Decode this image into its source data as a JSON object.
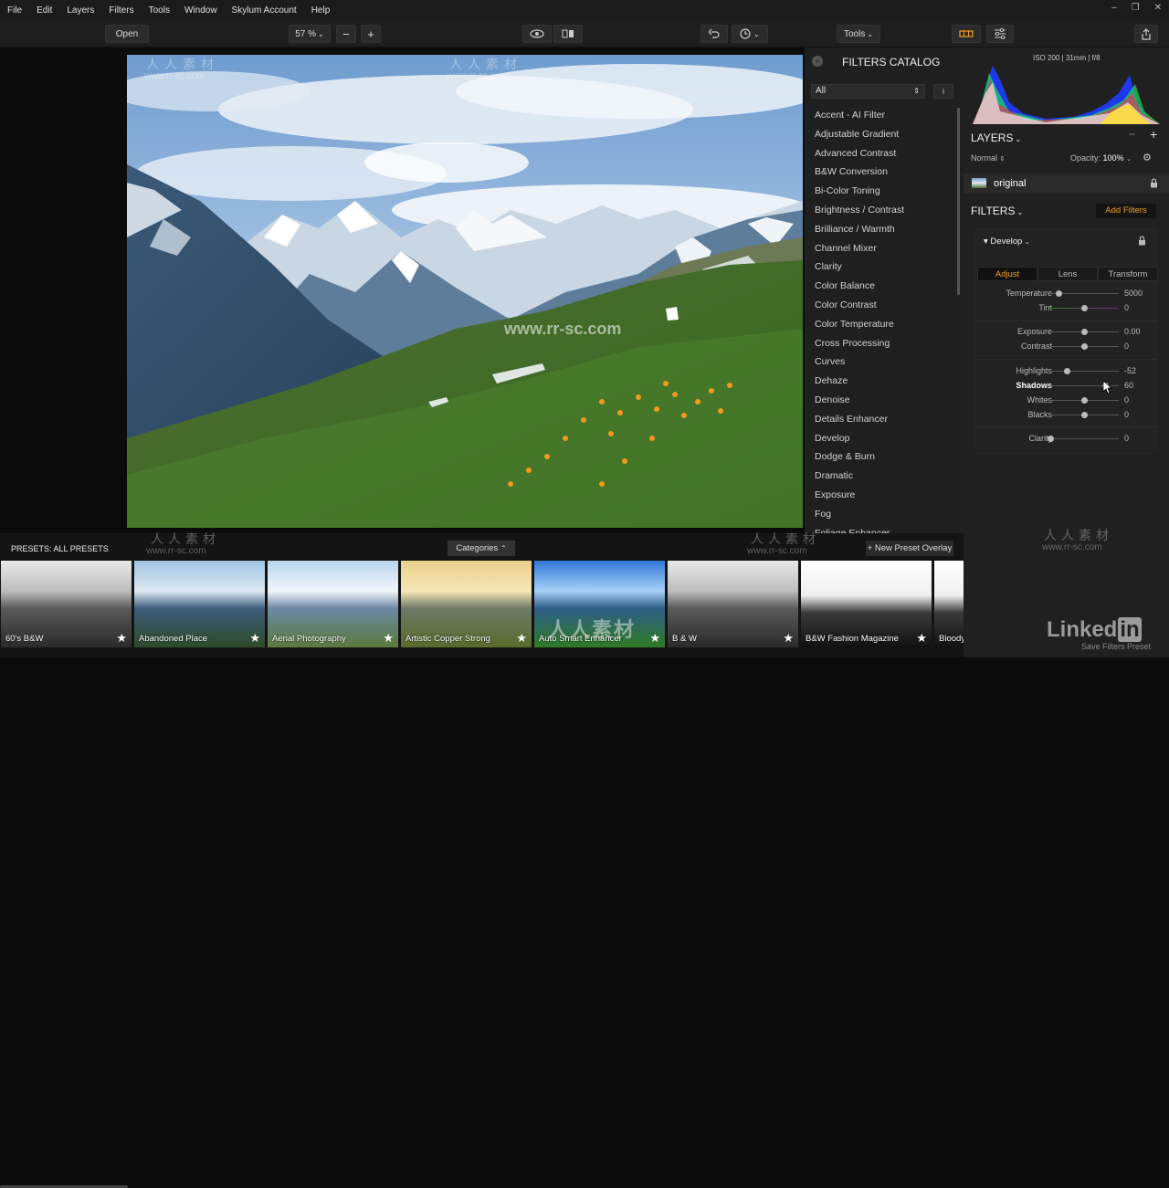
{
  "menu": [
    "File",
    "Edit",
    "Layers",
    "Filters",
    "Tools",
    "Window",
    "Skylum Account",
    "Help"
  ],
  "window_controls": {
    "minimize": "–",
    "maximize": "❐",
    "close": "✕"
  },
  "toolbar": {
    "open_label": "Open",
    "zoom_value": "57 %",
    "zoom_out": "−",
    "zoom_in": "+",
    "tools_label": "Tools"
  },
  "catalog": {
    "title": "FILTERS CATALOG",
    "filter_select": "All",
    "info_icon": "i",
    "items": [
      "Accent - AI Filter",
      "Adjustable Gradient",
      "Advanced Contrast",
      "B&W Conversion",
      "Bi-Color Toning",
      "Brightness / Contrast",
      "Brilliance / Warmth",
      "Channel Mixer",
      "Clarity",
      "Color Balance",
      "Color Contrast",
      "Color Temperature",
      "Cross Processing",
      "Curves",
      "Dehaze",
      "Denoise",
      "Details Enhancer",
      "Develop",
      "Dodge & Burn",
      "Dramatic",
      "Exposure",
      "Fog",
      "Foliage Enhancer"
    ]
  },
  "right_panel": {
    "exif": "ISO 200  |  31mm  |  f/8",
    "layers_title": "LAYERS",
    "blend_mode": "Normal",
    "opacity_label": "Opacity:",
    "opacity_value": "100%",
    "layer_name": "original",
    "filters_title": "FILTERS",
    "add_filters": "Add Filters",
    "develop_label": "Develop",
    "tabs": [
      "Adjust",
      "Lens",
      "Transform"
    ],
    "active_tab": "Adjust",
    "sliders": [
      {
        "label": "Temperature",
        "value": "5000",
        "pos": 0.13,
        "bold": false
      },
      {
        "label": "Tint",
        "value": "0",
        "pos": 0.5,
        "bold": false
      },
      {
        "label": "Exposure",
        "value": "0.00",
        "pos": 0.5,
        "bold": false
      },
      {
        "label": "Contrast",
        "value": "0",
        "pos": 0.5,
        "bold": false
      },
      {
        "label": "Highlights",
        "value": "-52",
        "pos": 0.24,
        "bold": false
      },
      {
        "label": "Shadows",
        "value": "60",
        "pos": 0.8,
        "bold": true
      },
      {
        "label": "Whites",
        "value": "0",
        "pos": 0.5,
        "bold": false
      },
      {
        "label": "Blacks",
        "value": "0",
        "pos": 0.5,
        "bold": false
      },
      {
        "label": "Clarity",
        "value": "0",
        "pos": 0.0,
        "bold": false
      }
    ],
    "save_preset": "Save Filters Preset"
  },
  "presets": {
    "title": "PRESETS: ALL PRESETS",
    "categories_label": "Categories",
    "new_overlay": "+ New Preset Overlay",
    "items": [
      {
        "name": "60's B&W",
        "style": "bw"
      },
      {
        "name": "Abandoned Place",
        "style": "cool"
      },
      {
        "name": "Aerial Photography",
        "style": "bright"
      },
      {
        "name": "Artistic Copper Strong",
        "style": "copper"
      },
      {
        "name": "Auto Smart Enhancer",
        "style": "vivid"
      },
      {
        "name": "B & W",
        "style": "bw"
      },
      {
        "name": "B&W Fashion Magazine",
        "style": "bwhigh"
      },
      {
        "name": "Bloody",
        "style": "bwhigh"
      }
    ]
  },
  "watermarks": {
    "cn": "人人素材",
    "url": "www.rr-sc.com",
    "center_url": "www.rr-sc.com"
  },
  "brand": {
    "linked": "Linked",
    "in": "in"
  }
}
